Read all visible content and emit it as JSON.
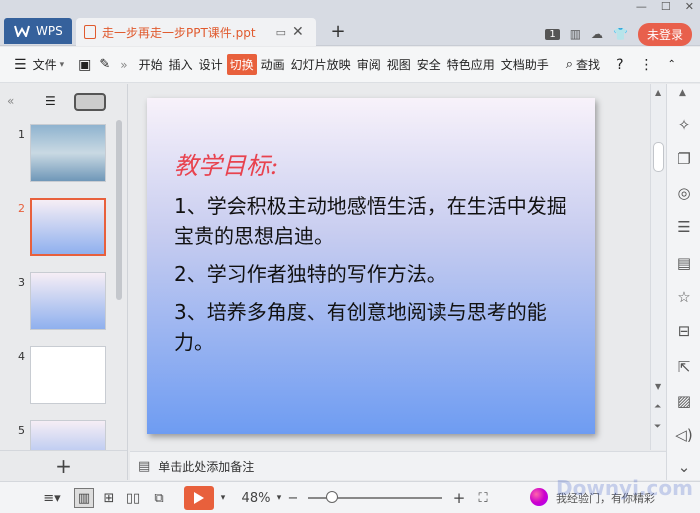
{
  "titlebar": {
    "app_tab": "WPS",
    "doc_tab_title": "走一步再走一步PPT课件.ppt",
    "badge_num": "1",
    "login_label": "未登录"
  },
  "menubar": {
    "file_label": "文件",
    "items": [
      "开始",
      "插入",
      "设计",
      "切换",
      "动画",
      "幻灯片放映",
      "审阅",
      "视图",
      "安全",
      "特色应用",
      "文档助手"
    ],
    "active_index": 3,
    "search_label": "查找"
  },
  "thumbnails": [
    {
      "num": "1"
    },
    {
      "num": "2"
    },
    {
      "num": "3"
    },
    {
      "num": "4"
    },
    {
      "num": "5"
    }
  ],
  "slide": {
    "heading": "教学目标:",
    "paragraphs": [
      "1、学会积极主动地感悟生活，在生活中发掘宝贵的思想启迪。",
      "2、学习作者独特的写作方法。",
      "3、培养多角度、有创意地阅读与思考的能力。"
    ]
  },
  "notes": {
    "placeholder": "单击此处添加备注"
  },
  "statusbar": {
    "zoom": "48%",
    "zoom_fraction": 0.18,
    "watermark_text": "Downyi.com",
    "watermark_sub": "我经验门，有你精彩"
  },
  "colors": {
    "accent": "#e8603c",
    "slide_heading": "#e8434f"
  }
}
